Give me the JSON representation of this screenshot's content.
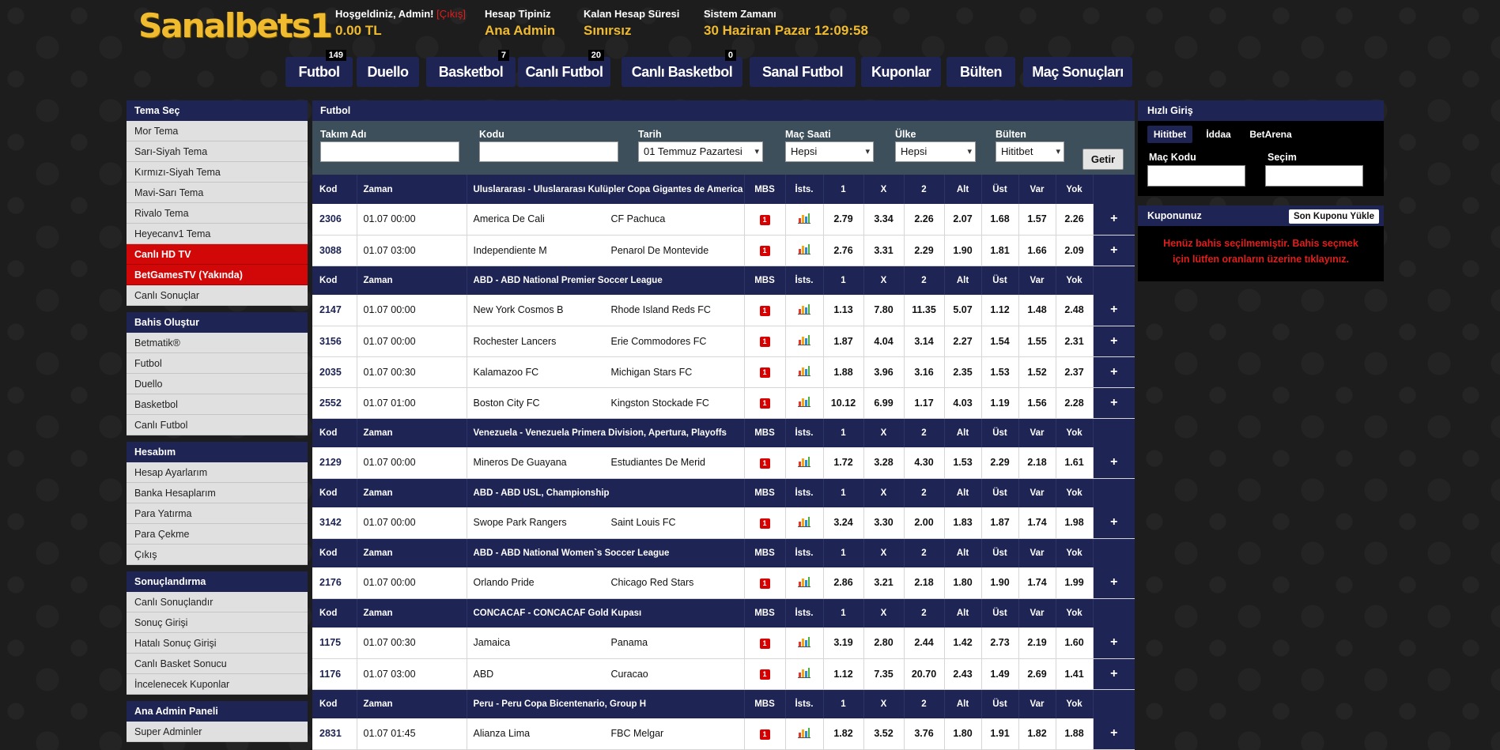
{
  "brand": "Sanalbets1",
  "header": {
    "welcome": "Hoşgeldiniz, Admin!",
    "logout": "[Çıkış]",
    "balance": "0.00 TL",
    "account_type_label": "Hesap Tipiniz",
    "account_type": "Ana Admin",
    "remaining_label": "Kalan Hesap Süresi",
    "remaining": "Sınırsız",
    "system_time_label": "Sistem Zamanı",
    "system_time": "30 Haziran Pazar 12:09:58"
  },
  "nav": [
    {
      "label": "Futbol",
      "badge": "149"
    },
    {
      "label": "Duello",
      "badge": ""
    },
    {
      "label": "Basketbol",
      "badge": "7"
    },
    {
      "label": "Canlı Futbol",
      "badge": "20"
    },
    {
      "label": "Canlı Basketbol",
      "badge": "0"
    },
    {
      "label": "Sanal Futbol",
      "badge": ""
    },
    {
      "label": "Kuponlar",
      "badge": ""
    },
    {
      "label": "Bülten",
      "badge": ""
    },
    {
      "label": "Maç Sonuçları",
      "badge": ""
    }
  ],
  "sidebar": [
    {
      "title": "Tema Seç",
      "items": [
        {
          "label": "Mor Tema",
          "red": false
        },
        {
          "label": "Sarı-Siyah Tema",
          "red": false
        },
        {
          "label": "Kırmızı-Siyah Tema",
          "red": false
        },
        {
          "label": "Mavi-Sarı Tema",
          "red": false
        },
        {
          "label": "Rivalo Tema",
          "red": false
        },
        {
          "label": "Heyecanv1 Tema",
          "red": false
        },
        {
          "label": "Canlı HD TV",
          "red": true
        },
        {
          "label": "BetGamesTV (Yakında)",
          "red": true
        },
        {
          "label": "Canlı Sonuçlar",
          "red": false
        }
      ]
    },
    {
      "title": "Bahis Oluştur",
      "items": [
        {
          "label": "Betmatik®",
          "red": false
        },
        {
          "label": "Futbol",
          "red": false
        },
        {
          "label": "Duello",
          "red": false
        },
        {
          "label": "Basketbol",
          "red": false
        },
        {
          "label": "Canlı Futbol",
          "red": false
        }
      ]
    },
    {
      "title": "Hesabım",
      "items": [
        {
          "label": "Hesap Ayarlarım",
          "red": false
        },
        {
          "label": "Banka Hesaplarım",
          "red": false
        },
        {
          "label": "Para Yatırma",
          "red": false
        },
        {
          "label": "Para Çekme",
          "red": false
        },
        {
          "label": "Çıkış",
          "red": false
        }
      ]
    },
    {
      "title": "Sonuçlandırma",
      "items": [
        {
          "label": "Canlı Sonuçlandır",
          "red": false
        },
        {
          "label": "Sonuç Girişi",
          "red": false
        },
        {
          "label": "Hatalı Sonuç Girişi",
          "red": false
        },
        {
          "label": "Canlı Basket Sonucu",
          "red": false
        },
        {
          "label": "İncelenecek Kuponlar",
          "red": false
        }
      ]
    },
    {
      "title": "Ana Admin Paneli",
      "items": [
        {
          "label": "Super Adminler",
          "red": false
        }
      ]
    }
  ],
  "main": {
    "title": "Futbol",
    "filters": {
      "team_label": "Takım Adı",
      "team_value": "",
      "code_label": "Kodu",
      "code_value": "",
      "date_label": "Tarih",
      "date_value": "01 Temmuz Pazartesi",
      "time_label": "Maç Saati",
      "time_value": "Hepsi",
      "country_label": "Ülke",
      "country_value": "Hepsi",
      "bulletin_label": "Bülten",
      "bulletin_value": "Hititbet",
      "submit": "Getir"
    },
    "columns": {
      "kod": "Kod",
      "zaman": "Zaman",
      "mbs": "MBS",
      "ists": "İsts.",
      "o1": "1",
      "ox": "X",
      "o2": "2",
      "alt": "Alt",
      "ust": "Üst",
      "var": "Var",
      "yok": "Yok"
    },
    "leagues": [
      {
        "name": "Uluslararası - Uluslararası Kulüpler Copa Gigantes de America",
        "matches": [
          {
            "kod": "2306",
            "zaman": "01.07 00:00",
            "home": "America De Cali",
            "away": "CF Pachuca",
            "mbs": "1",
            "odds": [
              "2.79",
              "3.34",
              "2.26",
              "2.07",
              "1.68",
              "1.57",
              "2.26"
            ]
          },
          {
            "kod": "3088",
            "zaman": "01.07 03:00",
            "home": "Independiente M",
            "away": "Penarol De Montevide",
            "mbs": "1",
            "odds": [
              "2.76",
              "3.31",
              "2.29",
              "1.90",
              "1.81",
              "1.66",
              "2.09"
            ]
          }
        ]
      },
      {
        "name": "ABD - ABD National Premier Soccer League",
        "matches": [
          {
            "kod": "2147",
            "zaman": "01.07 00:00",
            "home": "New York Cosmos B",
            "away": "Rhode Island Reds FC",
            "mbs": "1",
            "odds": [
              "1.13",
              "7.80",
              "11.35",
              "5.07",
              "1.12",
              "1.48",
              "2.48"
            ]
          },
          {
            "kod": "3156",
            "zaman": "01.07 00:00",
            "home": "Rochester Lancers",
            "away": "Erie Commodores FC",
            "mbs": "1",
            "odds": [
              "1.87",
              "4.04",
              "3.14",
              "2.27",
              "1.54",
              "1.55",
              "2.31"
            ]
          },
          {
            "kod": "2035",
            "zaman": "01.07 00:30",
            "home": "Kalamazoo FC",
            "away": "Michigan Stars FC",
            "mbs": "1",
            "odds": [
              "1.88",
              "3.96",
              "3.16",
              "2.35",
              "1.53",
              "1.52",
              "2.37"
            ]
          },
          {
            "kod": "2552",
            "zaman": "01.07 01:00",
            "home": "Boston City FC",
            "away": "Kingston Stockade FC",
            "mbs": "1",
            "odds": [
              "10.12",
              "6.99",
              "1.17",
              "4.03",
              "1.19",
              "1.56",
              "2.28"
            ]
          }
        ]
      },
      {
        "name": "Venezuela - Venezuela Primera Division, Apertura, Playoffs",
        "matches": [
          {
            "kod": "2129",
            "zaman": "01.07 00:00",
            "home": "Mineros De Guayana",
            "away": "Estudiantes De Merid",
            "mbs": "1",
            "odds": [
              "1.72",
              "3.28",
              "4.30",
              "1.53",
              "2.29",
              "2.18",
              "1.61"
            ]
          }
        ]
      },
      {
        "name": "ABD - ABD USL, Championship",
        "matches": [
          {
            "kod": "3142",
            "zaman": "01.07 00:00",
            "home": "Swope Park Rangers",
            "away": "Saint Louis FC",
            "mbs": "1",
            "odds": [
              "3.24",
              "3.30",
              "2.00",
              "1.83",
              "1.87",
              "1.74",
              "1.98"
            ]
          }
        ]
      },
      {
        "name": "ABD - ABD National Women`s Soccer League",
        "matches": [
          {
            "kod": "2176",
            "zaman": "01.07 00:00",
            "home": "Orlando Pride",
            "away": "Chicago Red Stars",
            "mbs": "1",
            "odds": [
              "2.86",
              "3.21",
              "2.18",
              "1.80",
              "1.90",
              "1.74",
              "1.99"
            ]
          }
        ]
      },
      {
        "name": "CONCACAF - CONCACAF Gold Kupası",
        "matches": [
          {
            "kod": "1175",
            "zaman": "01.07 00:30",
            "home": "Jamaica",
            "away": "Panama",
            "mbs": "1",
            "odds": [
              "3.19",
              "2.80",
              "2.44",
              "1.42",
              "2.73",
              "2.19",
              "1.60"
            ]
          },
          {
            "kod": "1176",
            "zaman": "01.07 03:00",
            "home": "ABD",
            "away": "Curacao",
            "mbs": "1",
            "odds": [
              "1.12",
              "7.35",
              "20.70",
              "2.43",
              "1.49",
              "2.69",
              "1.41"
            ]
          }
        ]
      },
      {
        "name": "Peru - Peru Copa Bicentenario, Group H",
        "matches": [
          {
            "kod": "2831",
            "zaman": "01.07 01:45",
            "home": "Alianza Lima",
            "away": "FBC Melgar",
            "mbs": "1",
            "odds": [
              "1.82",
              "3.52",
              "3.76",
              "1.80",
              "1.91",
              "1.82",
              "1.88"
            ]
          }
        ]
      }
    ],
    "add_label": "+"
  },
  "right": {
    "quick_title": "Hızlı Giriş",
    "tabs": [
      "Hititbet",
      "İddaa",
      "BetArena"
    ],
    "match_code_label": "Maç Kodu",
    "selection_label": "Seçim",
    "coupon_title": "Kuponunuz",
    "load_last": "Son Kuponu Yükle",
    "empty_msg": "Henüz bahis seçilmemiştir. Bahis seçmek için lütfen oranların üzerine tıklayınız."
  },
  "colors": {
    "navy": "#1e2453",
    "gold": "#f0bb2e",
    "red": "#d20707",
    "filter_bg": "#3c4f5a"
  }
}
